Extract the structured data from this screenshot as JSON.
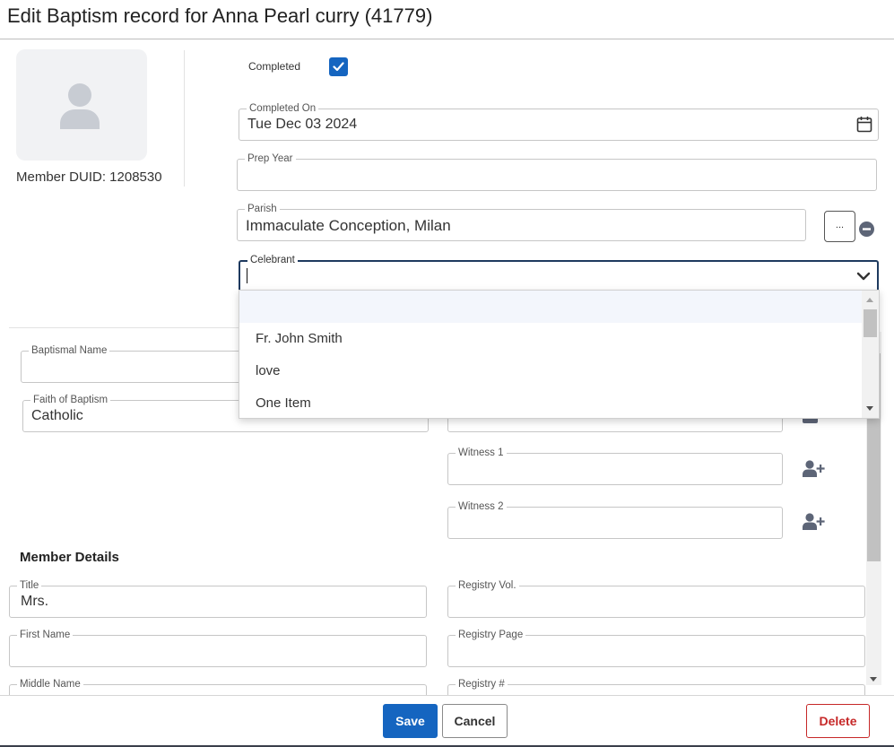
{
  "dialog": {
    "title": "Edit Baptism record for Anna Pearl curry (41779)"
  },
  "member": {
    "duid_label": "Member DUID: 1208530"
  },
  "form": {
    "completed_label": "Completed",
    "completed_checked": true,
    "completed_on": {
      "label": "Completed On",
      "value": "Tue Dec 03 2024"
    },
    "prep_year": {
      "label": "Prep Year",
      "value": ""
    },
    "parish": {
      "label": "Parish",
      "value": "Immaculate Conception, Milan",
      "picker_label": "..."
    },
    "celebrant": {
      "label": "Celebrant",
      "value": ""
    },
    "baptismal_name": {
      "label": "Baptismal Name",
      "value": ""
    },
    "faith_of_baptism": {
      "label": "Faith of Baptism",
      "value": "Catholic"
    },
    "witness1": {
      "label": "Witness 1",
      "value": ""
    },
    "witness2": {
      "label": "Witness 2",
      "value": ""
    }
  },
  "celebrant_options": [
    "",
    "Fr. John Smith",
    "love",
    "One Item"
  ],
  "member_details": {
    "section_title": "Member Details",
    "title": {
      "label": "Title",
      "value": "Mrs."
    },
    "first_name": {
      "label": "First Name",
      "value": ""
    },
    "middle_name": {
      "label": "Middle Name",
      "value": ""
    },
    "registry_vol": {
      "label": "Registry Vol.",
      "value": ""
    },
    "registry_page": {
      "label": "Registry Page",
      "value": ""
    },
    "registry_num": {
      "label": "Registry #",
      "value": ""
    }
  },
  "actions": {
    "save": "Save",
    "cancel": "Cancel",
    "delete": "Delete"
  },
  "icons": {
    "avatar": "person-silhouette-icon",
    "checkbox": "check-icon",
    "calendar": "calendar-icon",
    "chevron": "chevron-down-icon",
    "remove": "minus-circle-icon",
    "add_person": "user-plus-icon"
  },
  "colors": {
    "primary": "#1565c0",
    "danger": "#c62828",
    "focus_border": "#1e3a5f",
    "icon_gray": "#5d6577",
    "avatar_bg": "#f1f2f4"
  }
}
